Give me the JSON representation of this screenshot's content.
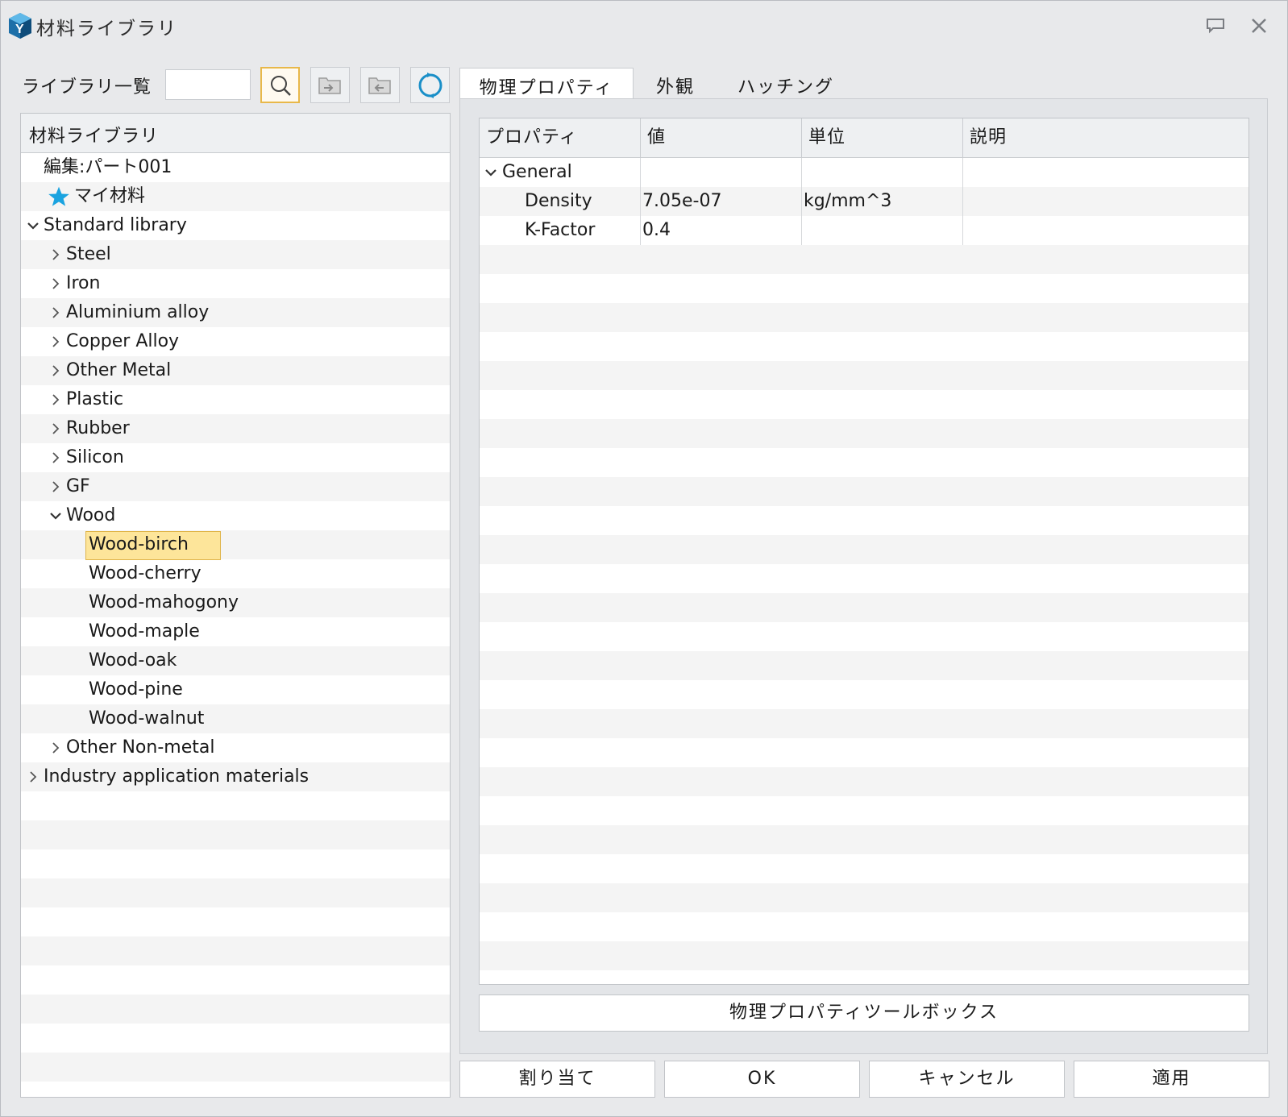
{
  "window": {
    "title": "材料ライブラリ"
  },
  "toolbar": {
    "library_list_label": "ライブラリ一覧",
    "search_value": ""
  },
  "tree": {
    "header": "材料ライブラリ",
    "items": [
      {
        "label": "編集:パート001",
        "level": 0,
        "chevron": "none"
      },
      {
        "label": "マイ材料",
        "level": 0,
        "chevron": "none",
        "icon": "star-icon"
      },
      {
        "label": "Standard library",
        "level": 0,
        "chevron": "down"
      },
      {
        "label": "Steel",
        "level": 1,
        "chevron": "right"
      },
      {
        "label": "Iron",
        "level": 1,
        "chevron": "right"
      },
      {
        "label": "Aluminium alloy",
        "level": 1,
        "chevron": "right"
      },
      {
        "label": "Copper Alloy",
        "level": 1,
        "chevron": "right"
      },
      {
        "label": "Other Metal",
        "level": 1,
        "chevron": "right"
      },
      {
        "label": "Plastic",
        "level": 1,
        "chevron": "right"
      },
      {
        "label": "Rubber",
        "level": 1,
        "chevron": "right"
      },
      {
        "label": "Silicon",
        "level": 1,
        "chevron": "right"
      },
      {
        "label": "GF",
        "level": 1,
        "chevron": "right"
      },
      {
        "label": "Wood",
        "level": 1,
        "chevron": "down"
      },
      {
        "label": "Wood-birch",
        "level": 2,
        "chevron": "none",
        "selected": true
      },
      {
        "label": "Wood-cherry",
        "level": 2,
        "chevron": "none"
      },
      {
        "label": "Wood-mahogony",
        "level": 2,
        "chevron": "none"
      },
      {
        "label": "Wood-maple",
        "level": 2,
        "chevron": "none"
      },
      {
        "label": "Wood-oak",
        "level": 2,
        "chevron": "none"
      },
      {
        "label": "Wood-pine",
        "level": 2,
        "chevron": "none"
      },
      {
        "label": "Wood-walnut",
        "level": 2,
        "chevron": "none"
      },
      {
        "label": "Other Non-metal",
        "level": 1,
        "chevron": "right"
      },
      {
        "label": "Industry application materials",
        "level": 0,
        "chevron": "right"
      }
    ]
  },
  "tabs": [
    {
      "label": "物理プロパティ",
      "active": true
    },
    {
      "label": "外観",
      "active": false
    },
    {
      "label": "ハッチング",
      "active": false
    }
  ],
  "grid": {
    "columns": [
      "プロパティ",
      "値",
      "単位",
      "説明"
    ],
    "rows": [
      {
        "property": "General",
        "value": "",
        "unit": "",
        "description": "",
        "group": true
      },
      {
        "property": "Density",
        "value": "7.05e-07",
        "unit": "kg/mm^3",
        "description": ""
      },
      {
        "property": "K-Factor",
        "value": "0.4",
        "unit": "",
        "description": ""
      }
    ]
  },
  "toolbox_button": "物理プロパティツールボックス",
  "buttons": {
    "assign": "割り当て",
    "ok": "OK",
    "cancel": "キャンセル",
    "apply": "適用"
  },
  "colors": {
    "selection_fill": "#fde59a",
    "selection_border": "#e0b54a",
    "star": "#1aa3e0",
    "refresh": "#1a8fc8"
  }
}
